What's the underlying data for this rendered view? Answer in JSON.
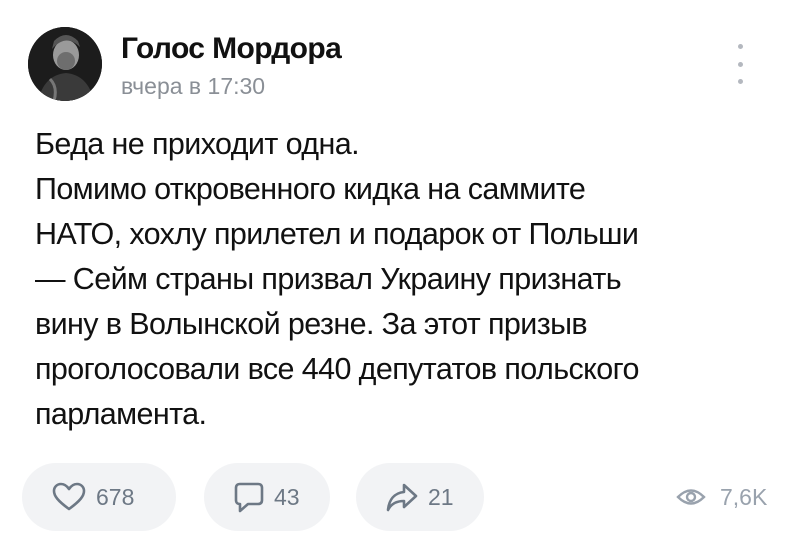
{
  "post": {
    "author": "Голос Мордора",
    "timestamp": "вчера в 17:30",
    "text_lines": [
      "Беда не приходит одна.",
      "Помимо откровенного кидка на саммите",
      "НАТО, хохлу прилетел и подарок от Польши",
      "— Сейм страны призвал Украину признать",
      "вину в Волынской резне. За этот призыв",
      "проголосовали все 440 депутатов польского",
      "парламента."
    ]
  },
  "actions": {
    "likes": "678",
    "comments": "43",
    "shares": "21",
    "views": "7,6K"
  },
  "icons": {
    "like": "heart-icon",
    "comment": "comment-icon",
    "share": "share-icon",
    "views": "eye-icon",
    "menu": "more-vertical-icon"
  },
  "colors": {
    "background": "#ffffff",
    "text": "#111111",
    "muted": "#8a8f96",
    "pill": "#f2f3f5",
    "icon": "#6d7885"
  }
}
